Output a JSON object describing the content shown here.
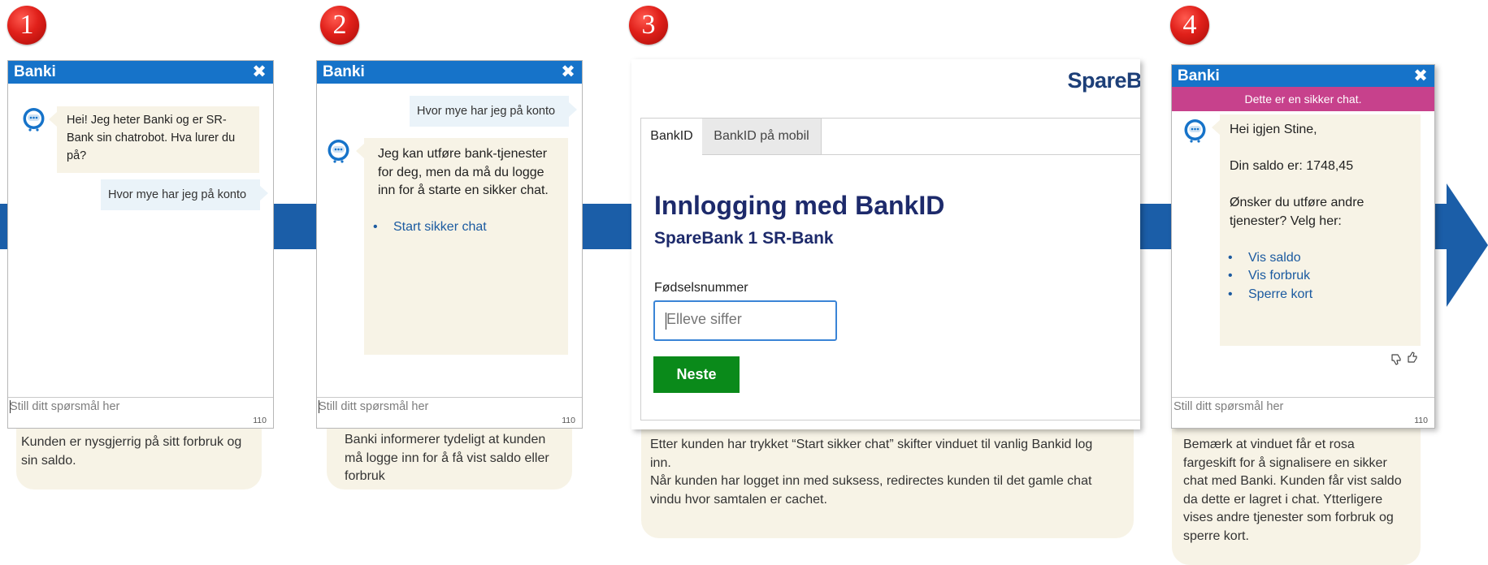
{
  "steps": [
    "1",
    "2",
    "3",
    "4"
  ],
  "chat_common": {
    "title": "Banki",
    "input_placeholder": "Still ditt spørsmål her",
    "char_counter": "110"
  },
  "panel1": {
    "bot_message": "Hei! Jeg heter Banki og er SR-Bank sin chatrobot. Hva lurer du på?",
    "user_message": "Hvor mye har jeg på konto"
  },
  "panel2": {
    "user_message": "Hvor mye har jeg på konto",
    "bot_message": "Jeg kan utføre bank-tjenester for deg, men da må du logge inn for å starte en sikker chat.",
    "link": "Start sikker chat"
  },
  "panel3": {
    "brand": "SpareB",
    "tabs": [
      "BankID",
      "BankID på mobil"
    ],
    "active_tab": 0,
    "heading": "Innlogging med BankID",
    "subheading": "SpareBank 1 SR-Bank",
    "field_label": "Fødselsnummer",
    "field_placeholder": "Elleve siffer",
    "next_button": "Neste"
  },
  "panel4": {
    "secure_banner": "Dette er en sikker chat.",
    "greeting": "Hei igjen Stine,",
    "balance": "Din saldo er: 1748,45",
    "question": "Ønsker du utføre andre tjenester? Velg her:",
    "links": [
      "Vis saldo",
      "Vis forbruk",
      "Sperre kort"
    ],
    "colors": {
      "secure_banner": "#c7418c"
    }
  },
  "captions": {
    "c1": "Kunden er nysgjerrig på sitt forbruk og sin saldo.",
    "c2": "Banki informerer tydeligt at kunden må logge inn for å få vist saldo eller forbruk",
    "c3_line1": "Etter kunden har trykket “Start sikker chat” skifter vinduet til vanlig Bankid log inn.",
    "c3_line2": "Når kunden har logget inn med suksess, redirectes kunden til det gamle chat vindu hvor samtalen er cachet.",
    "c4": "Bemærk at vinduet får et rosa fargeskift for å signalisere en sikker chat med Banki. Kunden får vist saldo da dette er lagret i chat. Ytterligere vises andre tjenester som forbruk og sperre kort."
  },
  "colors": {
    "flow_arrow": "#1b5ea8",
    "chat_header": "#1673c9",
    "link": "#1b5aa0",
    "bankid_heading": "#1d2a6b",
    "next_button": "#0a8a1a",
    "caption_bg": "#f7f3e6"
  }
}
